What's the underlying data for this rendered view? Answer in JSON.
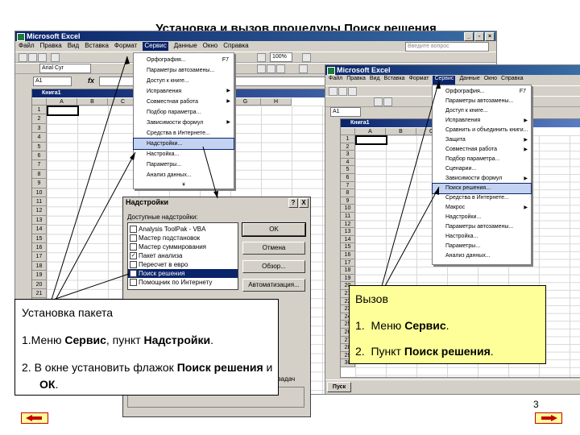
{
  "slide": {
    "title": "Установка и вызов процедуры Поиск решения",
    "page_number": "3"
  },
  "left_window": {
    "title": "Microsoft Excel",
    "menu": [
      "Файл",
      "Правка",
      "Вид",
      "Вставка",
      "Формат",
      "Сервис",
      "Данные",
      "Окно",
      "Справка"
    ],
    "active_menu": "Сервис",
    "search_placeholder": "Введите вопрос",
    "font_name": "Arial Cyr",
    "cell_ref": "A1",
    "fx": "fx",
    "zoom": "100%",
    "workbook_title": "Книга1",
    "columns": [
      "A",
      "B",
      "C",
      "D",
      "E",
      "F",
      "G",
      "H"
    ],
    "rows": [
      "1",
      "2",
      "3",
      "4",
      "5",
      "6",
      "7",
      "8",
      "9",
      "10",
      "11",
      "12",
      "13",
      "14",
      "15",
      "16",
      "17",
      "18",
      "19",
      "20",
      "21",
      "22",
      "23",
      "24",
      "25",
      "26"
    ],
    "service_menu": [
      {
        "label": "Орфография...",
        "shortcut": "F7"
      },
      {
        "label": "Параметры автозамены...",
        "shortcut": ""
      },
      {
        "label": "Доступ к книге...",
        "shortcut": ""
      },
      {
        "label": "Исправления",
        "arrow": true
      },
      {
        "label": "Совместная работа",
        "arrow": true
      },
      {
        "label": "Подбор параметра...",
        "shortcut": ""
      },
      {
        "label": "Зависимости формул",
        "arrow": true
      },
      {
        "label": "Средства в Интернете...",
        "shortcut": ""
      },
      {
        "label": "Надстройки...",
        "selected": true
      },
      {
        "label": "Настройка...",
        "shortcut": ""
      },
      {
        "label": "Параметры...",
        "shortcut": ""
      },
      {
        "label": "Анализ данных...",
        "shortcut": ""
      }
    ],
    "menu_more": "¥"
  },
  "addins_dialog": {
    "title": "Надстройки",
    "help_btn": "?",
    "close_btn": "X",
    "list_label": "Доступные надстройки:",
    "items": [
      {
        "label": "Analysis ToolPak - VBA",
        "checked": false
      },
      {
        "label": "Мастер подстановок",
        "checked": false
      },
      {
        "label": "Мастер суммирования",
        "checked": false
      },
      {
        "label": "Пакет анализа",
        "checked": true
      },
      {
        "label": "Пересчет в евро",
        "checked": false
      },
      {
        "label": "Поиск решения",
        "checked": false,
        "selected": true
      },
      {
        "label": "Помощник по Интернету",
        "checked": false
      }
    ],
    "ok_label": "OK",
    "cancel_label": "Отмена",
    "browse_label": "Обзор...",
    "automation_label": "Автоматизация...",
    "partial_text": "задач"
  },
  "right_window": {
    "title": "Microsoft Excel",
    "menu": [
      "Файл",
      "Правка",
      "Вид",
      "Вставка",
      "Формат",
      "Сервис",
      "Данные",
      "Окно",
      "Справка"
    ],
    "active_menu": "Сервис",
    "cell_ref": "A1",
    "workbook_title": "Книга1",
    "columns": [
      "A",
      "B",
      "C"
    ],
    "rows": [
      "1",
      "2",
      "3",
      "4",
      "5",
      "6",
      "7",
      "8",
      "9",
      "10",
      "11",
      "12",
      "13",
      "14",
      "15",
      "16",
      "17",
      "18",
      "19",
      "20",
      "21",
      "22",
      "23",
      "24",
      "25",
      "26",
      "27",
      "28",
      "29",
      "30"
    ],
    "service_menu": [
      {
        "label": "Орфография...",
        "shortcut": "F7"
      },
      {
        "label": "Параметры автозамены...",
        "shortcut": ""
      },
      {
        "label": "Доступ к книге...",
        "shortcut": ""
      },
      {
        "label": "Исправления",
        "arrow": true
      },
      {
        "label": "Сравнить и объединить книги...",
        "shortcut": ""
      },
      {
        "label": "Защита",
        "arrow": true
      },
      {
        "label": "Совместная работа",
        "arrow": true
      },
      {
        "label": "Подбор параметра...",
        "shortcut": ""
      },
      {
        "label": "Сценарии...",
        "shortcut": ""
      },
      {
        "label": "Зависимости формул",
        "arrow": true
      },
      {
        "label": "Поиск решения...",
        "selected": true
      },
      {
        "label": "Средства в Интернете...",
        "shortcut": ""
      },
      {
        "label": "Макрос",
        "arrow": true
      },
      {
        "label": "Надстройки...",
        "shortcut": ""
      },
      {
        "label": "Параметры автозамены...",
        "shortcut": ""
      },
      {
        "label": "Настройка...",
        "shortcut": ""
      },
      {
        "label": "Параметры...",
        "shortcut": ""
      },
      {
        "label": "Анализ данных...",
        "shortcut": ""
      }
    ],
    "taskbar_start": "Пуск"
  },
  "callout_left": {
    "heading": "Установка пакета",
    "step1_prefix": "1.Меню ",
    "step1_bold1": "Сервис",
    "step1_mid": ", пункт ",
    "step1_bold2": "Надстройки",
    "step1_end": ".",
    "step2_prefix": "2. В окне установить флажок ",
    "step2_bold1": "Поиск решения",
    "step2_mid": " и ",
    "step2_bold2": "ОК",
    "step2_end": "."
  },
  "callout_right": {
    "heading": "Вызов",
    "item1_num": "1.",
    "item1_prefix": "Меню ",
    "item1_bold": "Сервис",
    "item1_end": ".",
    "item2_num": "2.",
    "item2_prefix": "Пункт ",
    "item2_bold": "Поиск решения",
    "item2_end": "."
  },
  "colors": {
    "callout_right_bg": "#ffff99",
    "titlebar": "#0a246a"
  }
}
